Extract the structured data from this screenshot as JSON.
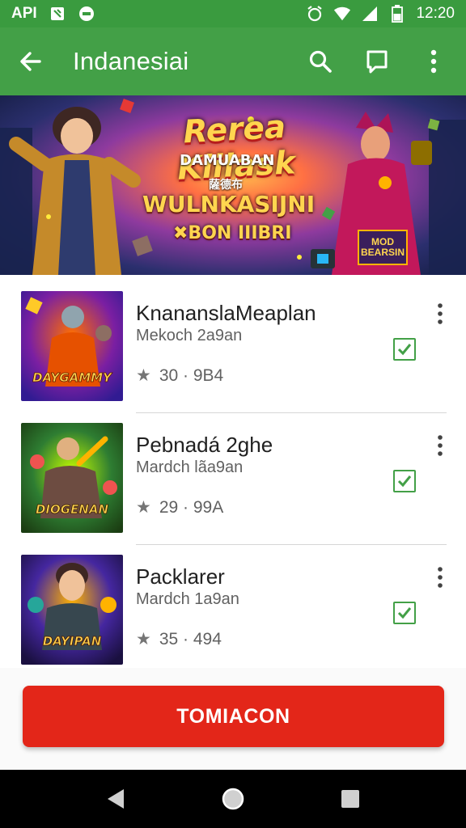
{
  "status_bar": {
    "left_label": "API",
    "time": "12:20",
    "icons": [
      "nfc-icon",
      "record-icon",
      "alarm-icon",
      "wifi-icon",
      "signal-icon",
      "battery-icon"
    ]
  },
  "app_bar": {
    "title": "Indanesiai",
    "icons": [
      "back-arrow-icon",
      "search-icon",
      "chat-icon",
      "more-vert-icon"
    ]
  },
  "banner": {
    "title": "Rerea Kiilask",
    "subtitle": "DAMUABAN",
    "small_text": "薩德布",
    "headline": "WULNKASIJNI",
    "tagline": "✖BON IIIBRI",
    "badge": "MOD BEARSIN"
  },
  "apps": [
    {
      "name": "KnananslaMeaplan",
      "sub": "Mekoch 2a9an",
      "rating": "30 · 9B4",
      "thumb_text": "DAYGAMMY",
      "thumb_colors": [
        "#6a1b9a",
        "#ff6f00"
      ],
      "checked": true
    },
    {
      "name": "Pebnadá 2ghe",
      "sub": "Mardch lãa9an",
      "rating": "29 · 99Α",
      "thumb_text": "DIOGENAN",
      "thumb_colors": [
        "#1b5e20",
        "#76ff03"
      ],
      "checked": true
    },
    {
      "name": "Packlarer",
      "sub": "Mardch 1a9an",
      "rating": "35 · 494",
      "thumb_text": "DAYIPAN",
      "thumb_colors": [
        "#311b92",
        "#ffb300"
      ],
      "checked": true
    }
  ],
  "cta": {
    "label": "TOMIACON"
  },
  "colors": {
    "accent": "#43a047",
    "status_bar": "#3a9b3f",
    "cta": "#e32619"
  },
  "navigation": {
    "icons": [
      "back-triangle-icon",
      "home-circle-icon",
      "recents-square-icon"
    ]
  }
}
